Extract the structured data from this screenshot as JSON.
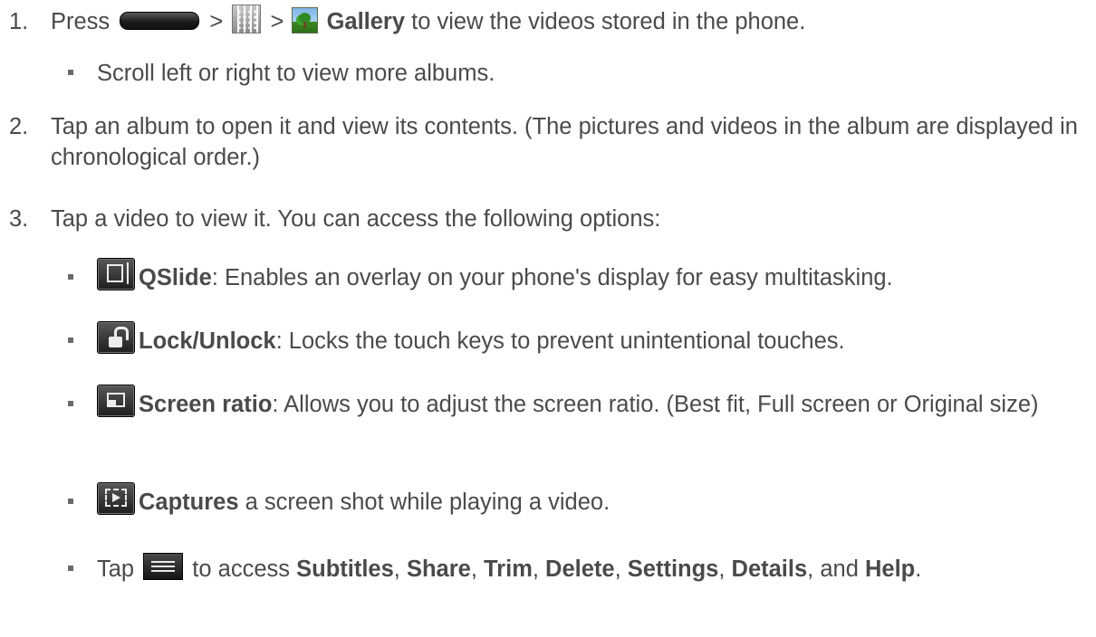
{
  "step1": {
    "num": "1.",
    "press": "Press",
    "sep1": ">",
    "sep2": ">",
    "gallery": "Gallery",
    "rest": " to view the videos stored in the phone.",
    "bullet": "Scroll left or right to view more albums."
  },
  "step2": {
    "num": "2.",
    "text": "Tap an album to open it and view its contents. (The pictures and videos in the album are displayed in chronological order.)"
  },
  "step3": {
    "num": "3.",
    "text": "Tap a video to view it. You can access the following options:"
  },
  "options": {
    "qslide": {
      "icon": "qslide-icon",
      "term": "QSlide",
      "desc": ": Enables an overlay on your phone's display for easy multitasking."
    },
    "lock": {
      "icon": "lock-icon",
      "term": "Lock/Unlock",
      "desc": ": Locks the touch keys to prevent unintentional touches."
    },
    "ratio": {
      "icon": "screen-ratio-icon",
      "term": "Screen ratio",
      "desc": ": Allows you to adjust the screen ratio. (Best fit, Full screen or Original size)"
    },
    "capture": {
      "icon": "capture-icon",
      "term": "Captures",
      "desc": " a screen shot while playing a video."
    },
    "menu": {
      "icon": "menu-icon",
      "tap": "Tap",
      "access": " to access ",
      "subtitles": "Subtitles",
      "c1": ", ",
      "share": "Share",
      "c2": ", ",
      "trim": "Trim",
      "c3": ", ",
      "delete": "Delete",
      "c4": ", ",
      "settings": "Settings",
      "c5": ", ",
      "details": "Details",
      "and": ", and ",
      "help": "Help",
      "end": "."
    }
  }
}
